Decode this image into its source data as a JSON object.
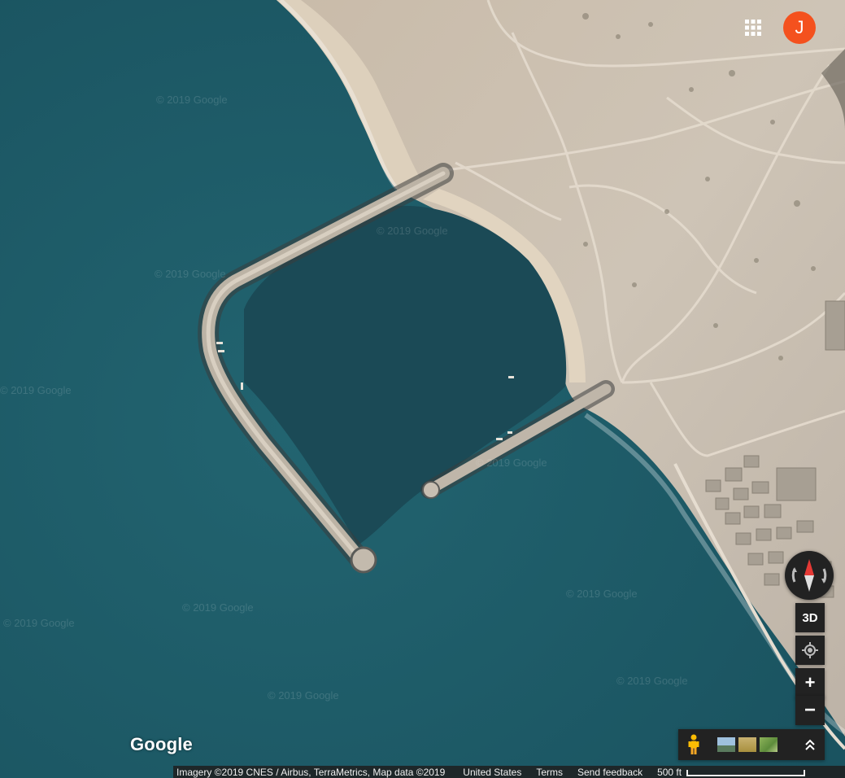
{
  "map": {
    "type": "satellite",
    "watermark": "© 2019 Google"
  },
  "header": {
    "apps_icon": "apps-grid-icon",
    "avatar_initial": "J",
    "avatar_color": "#f4511e"
  },
  "controls": {
    "compass_icon": "compass-icon",
    "three_d_label": "3D",
    "locate_icon": "my-location-icon",
    "zoom_in_label": "+",
    "zoom_out_label": "−",
    "pegman_icon": "pegman-icon",
    "expand_icon": "chevron-up-double-icon"
  },
  "branding": {
    "logo_text": "Google"
  },
  "footer": {
    "imagery": "Imagery ©2019 CNES / Airbus, TerraMetrics, Map data ©2019",
    "country": "United States",
    "terms": "Terms",
    "feedback": "Send feedback",
    "scale": "500 ft"
  },
  "colors": {
    "sea_deep": "#1f5a66",
    "sea_harbor": "#1b4b57",
    "land": "#cfc3b4",
    "sand": "#d9cbb6",
    "pier": "#bdb3a6"
  }
}
